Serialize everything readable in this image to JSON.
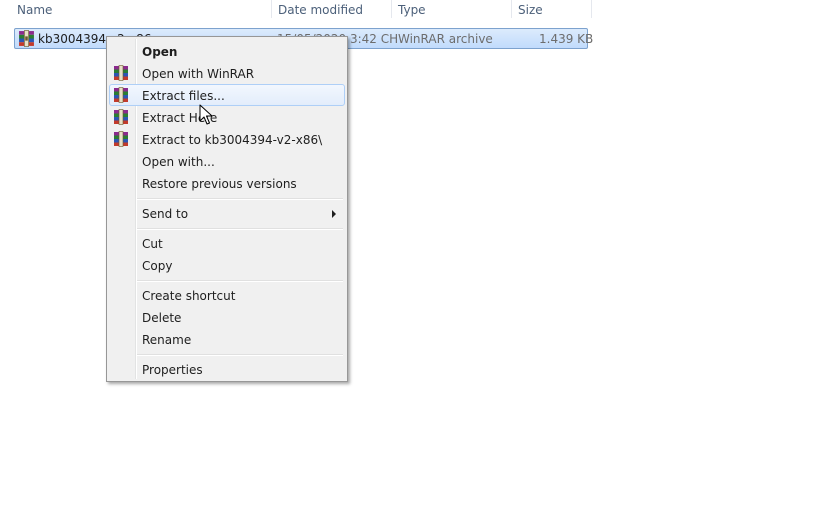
{
  "columns": {
    "name": "Name",
    "date_modified": "Date modified",
    "type": "Type",
    "size": "Size"
  },
  "file": {
    "name": "kb3004394-v2-x86",
    "date_modified": "15/05/2020 3:42 CH",
    "type": "WinRAR archive",
    "size": "1.439 KB",
    "icon": "winrar-archive-icon"
  },
  "context_menu": {
    "items": [
      {
        "label": "Open",
        "bold": true,
        "icon": null
      },
      {
        "label": "Open with WinRAR",
        "icon": "winrar-icon"
      },
      {
        "label": "Extract files...",
        "icon": "winrar-icon",
        "hovered": true
      },
      {
        "label": "Extract Here",
        "icon": "winrar-icon"
      },
      {
        "label": "Extract to kb3004394-v2-x86\\",
        "icon": "winrar-icon"
      },
      {
        "label": "Open with...",
        "icon": null
      },
      {
        "label": "Restore previous versions",
        "icon": null
      },
      {
        "label": "Send to",
        "icon": null,
        "submenu": true
      },
      {
        "label": "Cut",
        "icon": null
      },
      {
        "label": "Copy",
        "icon": null
      },
      {
        "label": "Create shortcut",
        "icon": null
      },
      {
        "label": "Delete",
        "icon": null
      },
      {
        "label": "Rename",
        "icon": null
      },
      {
        "label": "Properties",
        "icon": null
      }
    ]
  },
  "colors": {
    "selection_border": "#7da2ce",
    "selection_fill": "#c1dbfc",
    "hover_border": "#aecff7",
    "menu_background": "#f0f0f0",
    "header_text": "#4c607a"
  }
}
